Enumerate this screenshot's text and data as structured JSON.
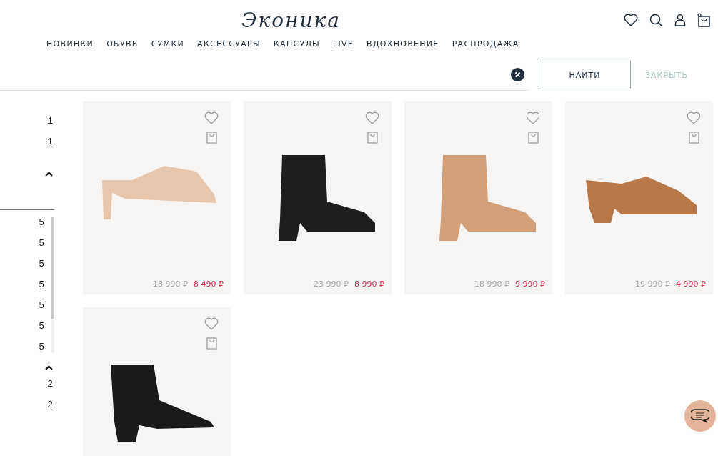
{
  "header": {
    "logo": "Эконика",
    "nav": [
      "НОВИНКИ",
      "ОБУВЬ",
      "СУМКИ",
      "АКСЕССУАРЫ",
      "КАПСУЛЫ",
      "LIVE",
      "ВДОХНОВЕНИЕ",
      "РАСПРОДАЖА"
    ]
  },
  "search": {
    "submit": "НАЙТИ",
    "close": "ЗАКРЫТЬ"
  },
  "sidebar": {
    "groups": [
      {
        "values": [
          "1",
          "1"
        ]
      },
      {
        "values": [
          "5",
          "5",
          "5",
          "5",
          "5",
          "5",
          "5"
        ],
        "expanded": true
      },
      {
        "values": [
          "2",
          "2"
        ],
        "expanded": true
      }
    ]
  },
  "products": [
    {
      "kind": "mule",
      "color": "#e6c7ad",
      "old_price": "18 990 ₽",
      "price": "8 490 ₽"
    },
    {
      "kind": "ankle-boot",
      "color": "#1e1e1e",
      "old_price": "23 990 ₽",
      "price": "8 990 ₽"
    },
    {
      "kind": "ankle-boot",
      "color": "#d29f78",
      "old_price": "18 990 ₽",
      "price": "9 990 ₽"
    },
    {
      "kind": "loafer",
      "color": "#b8784a",
      "old_price": "19 990 ₽",
      "price": "4 990 ₽"
    },
    {
      "kind": "western-boot",
      "color": "#1a1a1a"
    }
  ]
}
